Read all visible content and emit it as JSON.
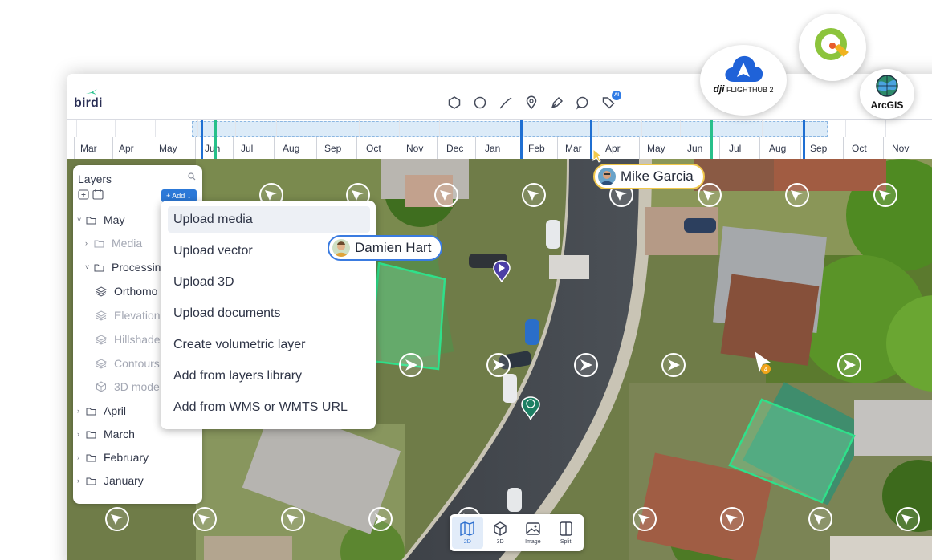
{
  "brand": {
    "name": "birdi"
  },
  "toolbar": {
    "tools": [
      "polygon-icon",
      "circle-icon",
      "line-icon",
      "pin-icon",
      "pen-icon",
      "comment-icon",
      "ai-tag-icon"
    ],
    "ai_badge": "AI"
  },
  "timeline": {
    "months": [
      "Mar",
      "Apr",
      "May",
      "Jun",
      "Jul",
      "Aug",
      "Sep",
      "Oct",
      "Nov",
      "Dec",
      "Jan",
      "Feb",
      "Mar",
      "Apr",
      "May",
      "Jun",
      "Jul",
      "Aug",
      "Sep",
      "Oct",
      "Nov"
    ]
  },
  "layers": {
    "title": "Layers",
    "add_label": "+ Add",
    "tree": [
      {
        "label": "May",
        "level": 0,
        "dim": false,
        "caret": "˅"
      },
      {
        "label": "Media",
        "level": 1,
        "dim": true,
        "caret": "›"
      },
      {
        "label": "Processing",
        "level": 1,
        "dim": false,
        "caret": "˅"
      },
      {
        "label": "Orthomo",
        "level": 2,
        "dim": false
      },
      {
        "label": "Elevation",
        "level": 2,
        "dim": true
      },
      {
        "label": "Hillshade",
        "level": 2,
        "dim": true
      },
      {
        "label": "Contours",
        "level": 2,
        "dim": true
      },
      {
        "label": "3D mode",
        "level": 2,
        "dim": true
      },
      {
        "label": "April",
        "level": 0,
        "dim": false,
        "caret": "›"
      },
      {
        "label": "March",
        "level": 0,
        "dim": false,
        "caret": "›"
      },
      {
        "label": "February",
        "level": 0,
        "dim": false,
        "caret": "›"
      },
      {
        "label": "January",
        "level": 0,
        "dim": false,
        "caret": "›"
      }
    ]
  },
  "add_menu": {
    "items": [
      "Upload media",
      "Upload vector",
      "Upload 3D",
      "Upload documents",
      "Create volumetric layer",
      "Add from layers library",
      "Add from WMS or WMTS URL"
    ]
  },
  "users": {
    "mike": "Mike Garcia",
    "damien": "Damien Hart"
  },
  "integrations": {
    "dji": "FLIGHTHUB 2",
    "dji_brand": "dji",
    "arcgis": "ArcGIS"
  },
  "views": [
    {
      "label": "2D",
      "icon": "map-icon",
      "active": true
    },
    {
      "label": "3D",
      "icon": "cube-icon",
      "active": false
    },
    {
      "label": "Image",
      "icon": "image-icon",
      "active": false
    },
    {
      "label": "Split",
      "icon": "split-icon",
      "active": false
    }
  ],
  "map_marker": {
    "count": "4"
  },
  "colors": {
    "accent": "#2c79d8",
    "marker_blue": "#1f6fd2",
    "marker_green": "#27c08a",
    "highlight": "#f2c94c"
  }
}
